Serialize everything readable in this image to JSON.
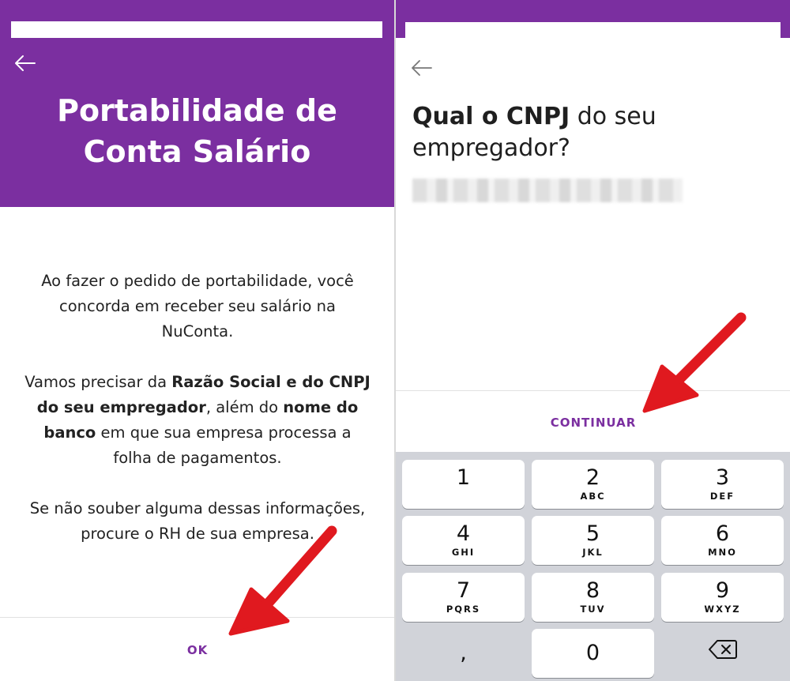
{
  "left_screen": {
    "title_line1": "Portabilidade de",
    "title_line2": "Conta Salário",
    "paragraph1": "Ao fazer o pedido de portabilidade, você concorda em receber seu salário na NuConta.",
    "paragraph2": {
      "part1": "Vamos precisar da ",
      "bold1": "Razão Social e do CNPJ do seu empregador",
      "part2": ", além do ",
      "bold2": "nome do banco",
      "part3": " em que sua empresa processa a folha de pagamentos."
    },
    "paragraph3": "Se não souber alguma dessas informações, procure o RH de sua empresa.",
    "ok_label": "OK"
  },
  "right_screen": {
    "question_bold": "Qual o CNPJ",
    "question_rest": " do seu empregador?",
    "continue_label": "CONTINUAR",
    "keypad": [
      {
        "digit": "1",
        "letters": ""
      },
      {
        "digit": "2",
        "letters": "ABC"
      },
      {
        "digit": "3",
        "letters": "DEF"
      },
      {
        "digit": "4",
        "letters": "GHI"
      },
      {
        "digit": "5",
        "letters": "JKL"
      },
      {
        "digit": "6",
        "letters": "MNO"
      },
      {
        "digit": "7",
        "letters": "PQRS"
      },
      {
        "digit": "8",
        "letters": "TUV"
      },
      {
        "digit": "9",
        "letters": "WXYZ"
      },
      {
        "digit": ",",
        "letters": ""
      },
      {
        "digit": "0",
        "letters": ""
      }
    ]
  },
  "colors": {
    "brand_purple": "#7b2fa0",
    "arrow_red": "#e0191f",
    "keyboard_bg": "#d1d3d9"
  },
  "icons": {
    "back": "arrow-left-icon",
    "backspace": "backspace-icon",
    "pointer": "red-arrow-icon"
  }
}
